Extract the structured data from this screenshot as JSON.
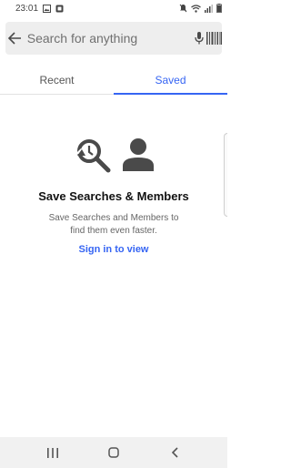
{
  "status_bar": {
    "time": "23:01",
    "left_icons": [
      "image-notification-icon",
      "app-notification-icon"
    ],
    "right_icons": [
      "mute-icon",
      "wifi-icon",
      "signal-icon",
      "battery-icon"
    ]
  },
  "search": {
    "placeholder": "Search for anything",
    "back_icon": "back-arrow-icon",
    "mic_icon": "mic-icon",
    "barcode_icon": "barcode-icon"
  },
  "tabs": [
    {
      "label": "Recent",
      "active": false
    },
    {
      "label": "Saved",
      "active": true
    }
  ],
  "empty_state": {
    "title": "Save Searches & Members",
    "description": "Save Searches and Members to find them even faster.",
    "link": "Sign in to view",
    "icons": [
      "saved-search-icon",
      "member-icon"
    ]
  },
  "nav_bar": {
    "icons": [
      "recent-apps-icon",
      "home-icon",
      "back-icon"
    ]
  },
  "colors": {
    "accent": "#3665f3",
    "icon_gray": "#4a4a4a",
    "search_bg": "#eeeeee"
  }
}
